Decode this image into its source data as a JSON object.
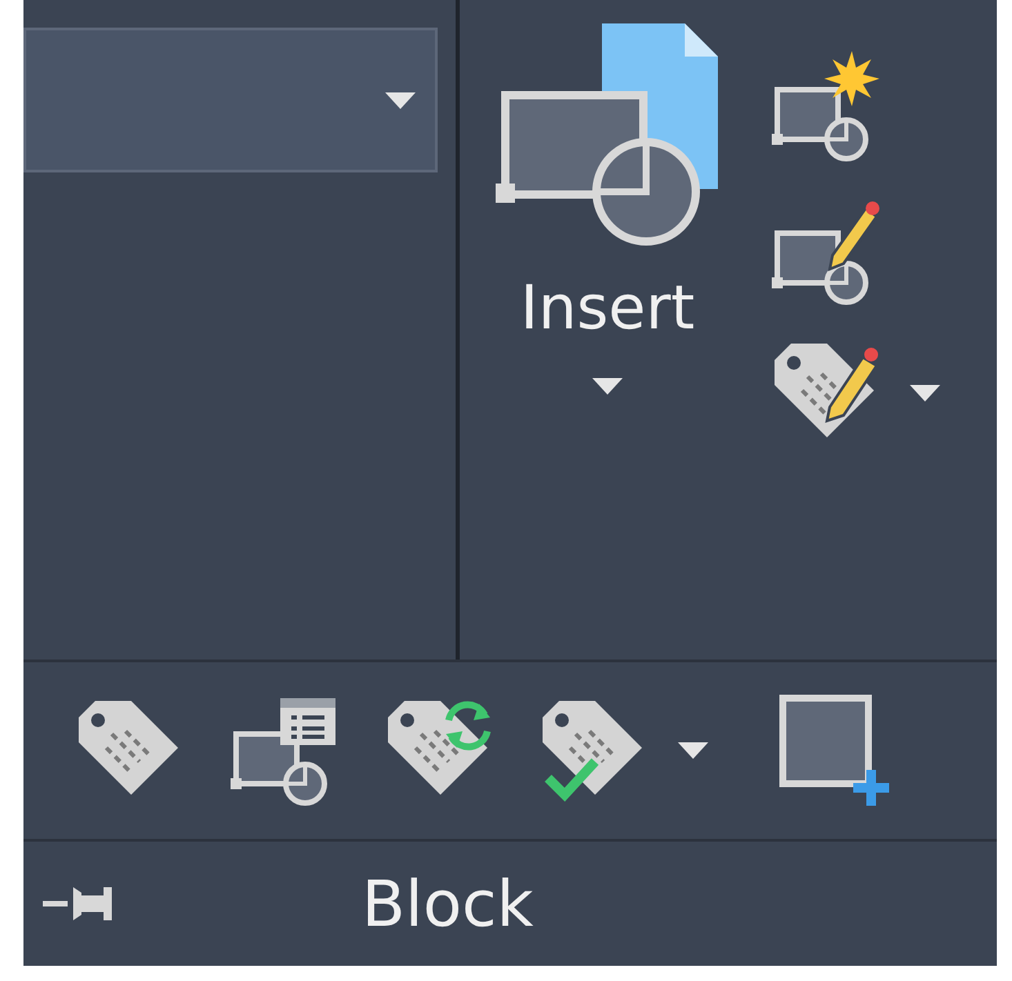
{
  "insert": {
    "label": "Insert"
  },
  "panel": {
    "title": "Block"
  }
}
